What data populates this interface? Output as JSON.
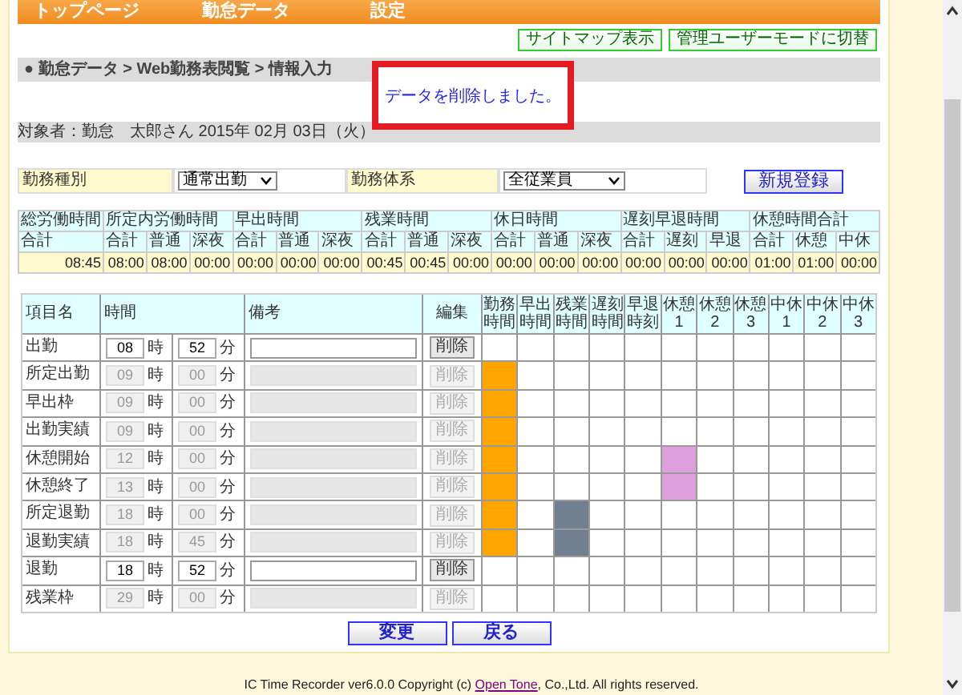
{
  "nav": [
    {
      "label": "トップページ"
    },
    {
      "label": "勤怠データ"
    },
    {
      "label": "設定"
    }
  ],
  "top_buttons": [
    "サイトマップ表示",
    "管理ユーザーモードに切替"
  ],
  "breadcrumb": "● 勤怠データ > Web勤務表閲覧 > 情報入力",
  "message": "データを削除しました。",
  "target": "対象者：勤怠　太郎さん 2015年 02月 03日（火）",
  "form": {
    "work_type_label": "勤務種別",
    "work_type_value": "通常出勤",
    "work_system_label": "勤務体系",
    "work_system_value": "全従業員",
    "new_button": "新規登録"
  },
  "summary": [
    {
      "label": "総労働時間",
      "columns": [
        {
          "label": "合計",
          "value": "08:45"
        }
      ]
    },
    {
      "label": "所定内労働時間",
      "columns": [
        {
          "label": "合計",
          "value": "08:00"
        },
        {
          "label": "普通",
          "value": "08:00"
        },
        {
          "label": "深夜",
          "value": "00:00"
        }
      ]
    },
    {
      "label": "早出時間",
      "columns": [
        {
          "label": "合計",
          "value": "00:00"
        },
        {
          "label": "普通",
          "value": "00:00"
        },
        {
          "label": "深夜",
          "value": "00:00"
        }
      ]
    },
    {
      "label": "残業時間",
      "columns": [
        {
          "label": "合計",
          "value": "00:45"
        },
        {
          "label": "普通",
          "value": "00:45"
        },
        {
          "label": "深夜",
          "value": "00:00"
        }
      ]
    },
    {
      "label": "休日時間",
      "columns": [
        {
          "label": "合計",
          "value": "00:00"
        },
        {
          "label": "普通",
          "value": "00:00"
        },
        {
          "label": "深夜",
          "value": "00:00"
        }
      ]
    },
    {
      "label": "遅刻早退時間",
      "columns": [
        {
          "label": "合計",
          "value": "00:00"
        },
        {
          "label": "遅刻",
          "value": "00:00"
        },
        {
          "label": "早退",
          "value": "00:00"
        }
      ]
    },
    {
      "label": "休憩時間合計",
      "columns": [
        {
          "label": "合計",
          "value": "01:00"
        },
        {
          "label": "休憩",
          "value": "01:00"
        },
        {
          "label": "中休",
          "value": "00:00"
        }
      ]
    }
  ],
  "table": {
    "name": "項目名",
    "time": "時間",
    "note": "備考",
    "edit": "編集",
    "timeline": [
      [
        "勤務",
        "時間"
      ],
      [
        "早出",
        "時間"
      ],
      [
        "残業",
        "時間"
      ],
      [
        "遅刻",
        "時間"
      ],
      [
        "早退",
        "時刻"
      ],
      [
        "休憩",
        "1"
      ],
      [
        "休憩",
        "2"
      ],
      [
        "休憩",
        "3"
      ],
      [
        "中休",
        "1"
      ],
      [
        "中休",
        "2"
      ],
      [
        "中休",
        "3"
      ]
    ],
    "rows": [
      {
        "name": "出勤",
        "hour": "08",
        "hour_unit": "時",
        "minute": "52",
        "minute_unit": "分",
        "editable": true,
        "delete": "削除",
        "cells": [
          {
            "filled": false
          },
          {
            "filled": false
          },
          {
            "filled": false
          },
          {
            "filled": false
          },
          {
            "filled": false
          },
          {
            "filled": false
          },
          {
            "filled": false
          },
          {
            "filled": false
          },
          {
            "filled": false
          },
          {
            "filled": false
          },
          {
            "filled": false
          }
        ]
      },
      {
        "name": "所定出勤",
        "hour": "09",
        "hour_unit": "時",
        "minute": "00",
        "minute_unit": "分",
        "editable": false,
        "delete": "削除",
        "cells": [
          {
            "filled": true,
            "color": "#ffa500"
          },
          {
            "filled": false
          },
          {
            "filled": false
          },
          {
            "filled": false
          },
          {
            "filled": false
          },
          {
            "filled": false
          },
          {
            "filled": false
          },
          {
            "filled": false
          },
          {
            "filled": false
          },
          {
            "filled": false
          },
          {
            "filled": false
          }
        ]
      },
      {
        "name": "早出枠",
        "hour": "09",
        "hour_unit": "時",
        "minute": "00",
        "minute_unit": "分",
        "editable": false,
        "delete": "削除",
        "cells": [
          {
            "filled": true,
            "color": "#ffa500"
          },
          {
            "filled": false
          },
          {
            "filled": false
          },
          {
            "filled": false
          },
          {
            "filled": false
          },
          {
            "filled": false
          },
          {
            "filled": false
          },
          {
            "filled": false
          },
          {
            "filled": false
          },
          {
            "filled": false
          },
          {
            "filled": false
          }
        ]
      },
      {
        "name": "出勤実績",
        "hour": "09",
        "hour_unit": "時",
        "minute": "00",
        "minute_unit": "分",
        "editable": false,
        "delete": "削除",
        "cells": [
          {
            "filled": true,
            "color": "#ffa500"
          },
          {
            "filled": false
          },
          {
            "filled": false
          },
          {
            "filled": false
          },
          {
            "filled": false
          },
          {
            "filled": false
          },
          {
            "filled": false
          },
          {
            "filled": false
          },
          {
            "filled": false
          },
          {
            "filled": false
          },
          {
            "filled": false
          }
        ]
      },
      {
        "name": "休憩開始",
        "hour": "12",
        "hour_unit": "時",
        "minute": "00",
        "minute_unit": "分",
        "editable": false,
        "delete": "削除",
        "cells": [
          {
            "filled": true,
            "color": "#ffa500"
          },
          {
            "filled": false
          },
          {
            "filled": false
          },
          {
            "filled": false
          },
          {
            "filled": false
          },
          {
            "filled": true,
            "color": "#dda0dd"
          },
          {
            "filled": false
          },
          {
            "filled": false
          },
          {
            "filled": false
          },
          {
            "filled": false
          },
          {
            "filled": false
          }
        ]
      },
      {
        "name": "休憩終了",
        "hour": "13",
        "hour_unit": "時",
        "minute": "00",
        "minute_unit": "分",
        "editable": false,
        "delete": "削除",
        "cells": [
          {
            "filled": true,
            "color": "#ffa500"
          },
          {
            "filled": false
          },
          {
            "filled": false
          },
          {
            "filled": false
          },
          {
            "filled": false
          },
          {
            "filled": true,
            "color": "#dda0dd"
          },
          {
            "filled": false
          },
          {
            "filled": false
          },
          {
            "filled": false
          },
          {
            "filled": false
          },
          {
            "filled": false
          }
        ]
      },
      {
        "name": "所定退勤",
        "hour": "18",
        "hour_unit": "時",
        "minute": "00",
        "minute_unit": "分",
        "editable": false,
        "delete": "削除",
        "cells": [
          {
            "filled": true,
            "color": "#ffa500"
          },
          {
            "filled": false
          },
          {
            "filled": true,
            "color": "#708090"
          },
          {
            "filled": false
          },
          {
            "filled": false
          },
          {
            "filled": false
          },
          {
            "filled": false
          },
          {
            "filled": false
          },
          {
            "filled": false
          },
          {
            "filled": false
          },
          {
            "filled": false
          }
        ]
      },
      {
        "name": "退勤実績",
        "hour": "18",
        "hour_unit": "時",
        "minute": "45",
        "minute_unit": "分",
        "editable": false,
        "delete": "削除",
        "cells": [
          {
            "filled": true,
            "color": "#ffa500"
          },
          {
            "filled": false
          },
          {
            "filled": true,
            "color": "#708090"
          },
          {
            "filled": false
          },
          {
            "filled": false
          },
          {
            "filled": false
          },
          {
            "filled": false
          },
          {
            "filled": false
          },
          {
            "filled": false
          },
          {
            "filled": false
          },
          {
            "filled": false
          }
        ]
      },
      {
        "name": "退勤",
        "hour": "18",
        "hour_unit": "時",
        "minute": "52",
        "minute_unit": "分",
        "editable": true,
        "delete": "削除",
        "cells": [
          {
            "filled": false
          },
          {
            "filled": false
          },
          {
            "filled": false
          },
          {
            "filled": false
          },
          {
            "filled": false
          },
          {
            "filled": false
          },
          {
            "filled": false
          },
          {
            "filled": false
          },
          {
            "filled": false
          },
          {
            "filled": false
          },
          {
            "filled": false
          }
        ]
      },
      {
        "name": "残業枠",
        "hour": "29",
        "hour_unit": "時",
        "minute": "00",
        "minute_unit": "分",
        "editable": false,
        "delete": "削除",
        "cells": [
          {
            "filled": false
          },
          {
            "filled": false
          },
          {
            "filled": false
          },
          {
            "filled": false
          },
          {
            "filled": false
          },
          {
            "filled": false
          },
          {
            "filled": false
          },
          {
            "filled": false
          },
          {
            "filled": false
          },
          {
            "filled": false
          },
          {
            "filled": false
          }
        ]
      }
    ]
  },
  "buttons": [
    "変更",
    "戻る"
  ],
  "footer": {
    "before": "IC Time Recorder ver6.0.0 Copyright (c)",
    "link": "Open Tone",
    "after": ", Co.,Ltd. All rights reserved."
  }
}
